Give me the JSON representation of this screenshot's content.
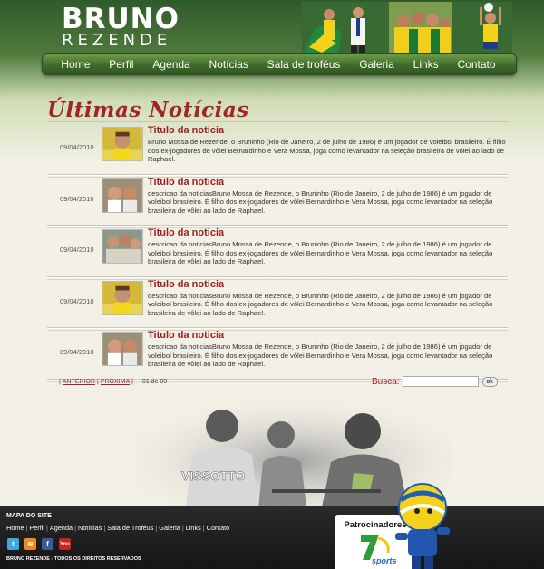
{
  "header": {
    "logo_line1": "BRUNO",
    "logo_line2": "REZENDE"
  },
  "nav": {
    "items": [
      {
        "label": "Home"
      },
      {
        "label": "Perfil"
      },
      {
        "label": "Agenda"
      },
      {
        "label": "Notícias"
      },
      {
        "label": "Sala de troféus"
      },
      {
        "label": "Galeria"
      },
      {
        "label": "Links"
      },
      {
        "label": "Contato"
      }
    ]
  },
  "main": {
    "section_title": "Últimas Notícias",
    "news": [
      {
        "date": "09/04/2010",
        "title": "Titulo da noticia",
        "text": "Bruno Mossa de Rezende, o Bruninho (Rio de Janeiro, 2 de julho de 1986) é um jogador de voleibol brasileiro. É filho dos ex-jogadores de vôlei Bernardinho e Vera Mossa, joga como levantador na seleção brasileira de vôlei ao lado de Raphael."
      },
      {
        "date": "09/04/2010",
        "title": "Titulo da noticia",
        "text": "descricao da noticiasBruno Mossa de Rezende, o Bruninho (Rio de Janeiro, 2 de julho de 1986) é um jogador de voleibol brasileiro. É filho dos ex-jogadores de vôlei Bernardinho e Vera Mossa, joga como levantador na seleção brasileira de vôlei ao lado de Raphael."
      },
      {
        "date": "09/04/2010",
        "title": "Titulo da noticia",
        "text": "descricao da noticiasBruno Mossa de Rezende, o Bruninho (Rio de Janeiro, 2 de julho de 1986) é um jogador de voleibol brasileiro. É filho dos ex-jogadores de vôlei Bernardinho e Vera Mossa, joga como levantador na seleção brasileira de vôlei ao lado de Raphael."
      },
      {
        "date": "09/04/2010",
        "title": "Titulo da noticia",
        "text": "descricao da noticiasBruno Mossa de Rezende, o Bruninho (Rio de Janeiro, 2 de julho de 1986) é um jogador de voleibol brasileiro. É filho dos ex-jogadores de vôlei Bernardinho e Vera Mossa, joga como levantador na seleção brasileira de vôlei ao lado de Raphael."
      },
      {
        "date": "09/04/2010",
        "title": "Titulo da noticia",
        "text": "descricao da noticiasBruno Mossa de Rezende, o Bruninho (Rio de Janeiro, 2 de julho de 1986) é um jogador de voleibol brasileiro. É filho dos ex-jogadores de vôlei Bernardinho e Vera Mossa, joga como levantador na seleção brasileira de vôlei ao lado de Raphael."
      }
    ],
    "pager": {
      "prev_label": "ANTERIOR",
      "next_label": "PRÓXIMA",
      "count": "01 de 09"
    },
    "search": {
      "label": "Busca:",
      "value": "",
      "button_label": "ok"
    },
    "hero_jersey_text": "VISSOTTO"
  },
  "footer": {
    "sitemap_title": "MAPA DO SITE",
    "links": [
      {
        "label": "Home"
      },
      {
        "label": "Perfil"
      },
      {
        "label": "Agenda"
      },
      {
        "label": "Notícias"
      },
      {
        "label": "Sala de Troféus"
      },
      {
        "label": "Galeria"
      },
      {
        "label": "Links"
      },
      {
        "label": "Contato"
      }
    ],
    "social_icons": [
      "twitter-icon",
      "rss-icon",
      "facebook-icon",
      "youtube-icon"
    ],
    "copyright": "BRUNO REZENDE - TODOS OS DIREITOS RESERVADOS",
    "sponsors_title": "Patrocinadores",
    "sponsor_logo_text": "sports"
  },
  "colors": {
    "accent_red": "#a0242a",
    "nav_green": "#3f6b2a",
    "footer_dark": "#1c1c1c"
  }
}
